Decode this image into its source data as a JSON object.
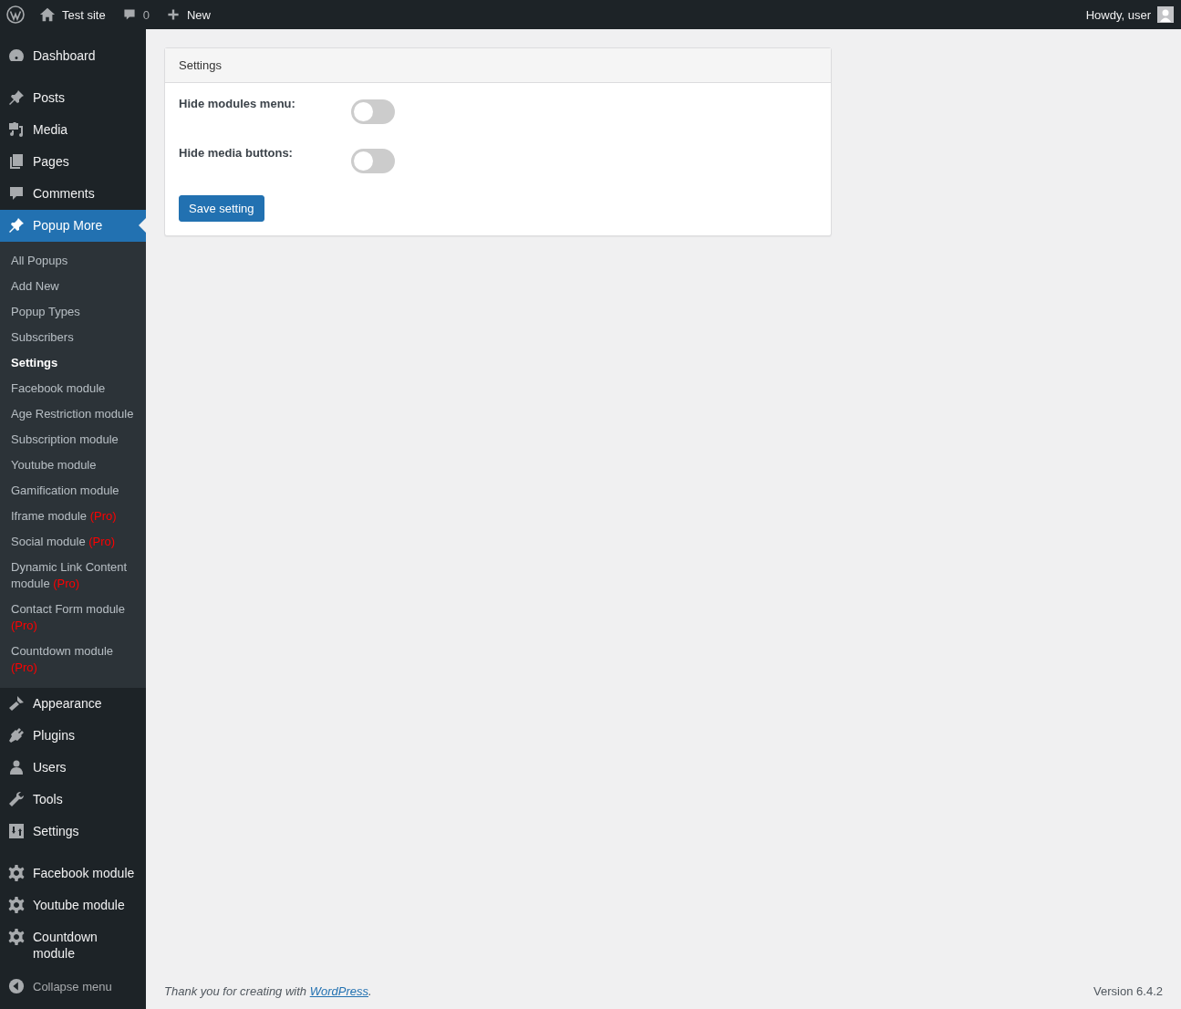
{
  "admin_bar": {
    "site": "Test site",
    "comments": "0",
    "new": "New",
    "greeting": "Howdy, user"
  },
  "menu_groups": [
    [
      {
        "label": "Dashboard",
        "selected": false
      }
    ],
    [
      {
        "label": "Posts",
        "selected": false
      },
      {
        "label": "Media",
        "selected": false
      },
      {
        "label": "Pages",
        "selected": false
      },
      {
        "label": "Comments",
        "selected": false
      },
      {
        "label": "Popup More",
        "selected": true,
        "expanded": true,
        "children": [
          {
            "label": "All Popups",
            "selected": false
          },
          {
            "label": "Add New",
            "selected": false
          },
          {
            "label": "Popup Types",
            "selected": false
          },
          {
            "label": "Subscribers",
            "selected": false
          },
          {
            "label": "Settings",
            "selected": true
          },
          {
            "label": "Facebook module",
            "selected": false
          },
          {
            "label": "Age Restriction module",
            "selected": false
          },
          {
            "label": "Subscription module",
            "selected": false
          },
          {
            "label": "Youtube module",
            "selected": false
          },
          {
            "label": "Gamification module",
            "selected": false
          },
          {
            "label": "Iframe module",
            "badge": "(Pro)",
            "selected": false
          },
          {
            "label": "Social module",
            "badge": "(Pro)",
            "selected": false
          },
          {
            "label": "Dynamic Link Content module",
            "badge": "(Pro)",
            "selected": false
          },
          {
            "label": "Contact Form module",
            "badge": "(Pro)",
            "selected": false
          },
          {
            "label": "Countdown module",
            "badge": "(Pro)",
            "selected": false
          }
        ]
      },
      {
        "label": "Appearance",
        "selected": false
      },
      {
        "label": "Plugins",
        "selected": false
      },
      {
        "label": "Users",
        "selected": false
      },
      {
        "label": "Tools",
        "selected": false
      },
      {
        "label": "Settings",
        "selected": false
      }
    ],
    [
      {
        "label": "Facebook module",
        "selected": false
      },
      {
        "label": "Youtube module",
        "selected": false
      },
      {
        "label": "Countdown module",
        "selected": false
      }
    ]
  ],
  "collapse": "Collapse menu",
  "panel": {
    "title": "Settings",
    "options": [
      {
        "label": "Hide modules menu:",
        "on": false
      },
      {
        "label": "Hide media buttons:",
        "on": false
      }
    ],
    "button": "Save setting"
  },
  "footer": {
    "text": "Thank you for creating with ",
    "link": "WordPress",
    "after": ".",
    "version": "Version 6.4.2"
  }
}
